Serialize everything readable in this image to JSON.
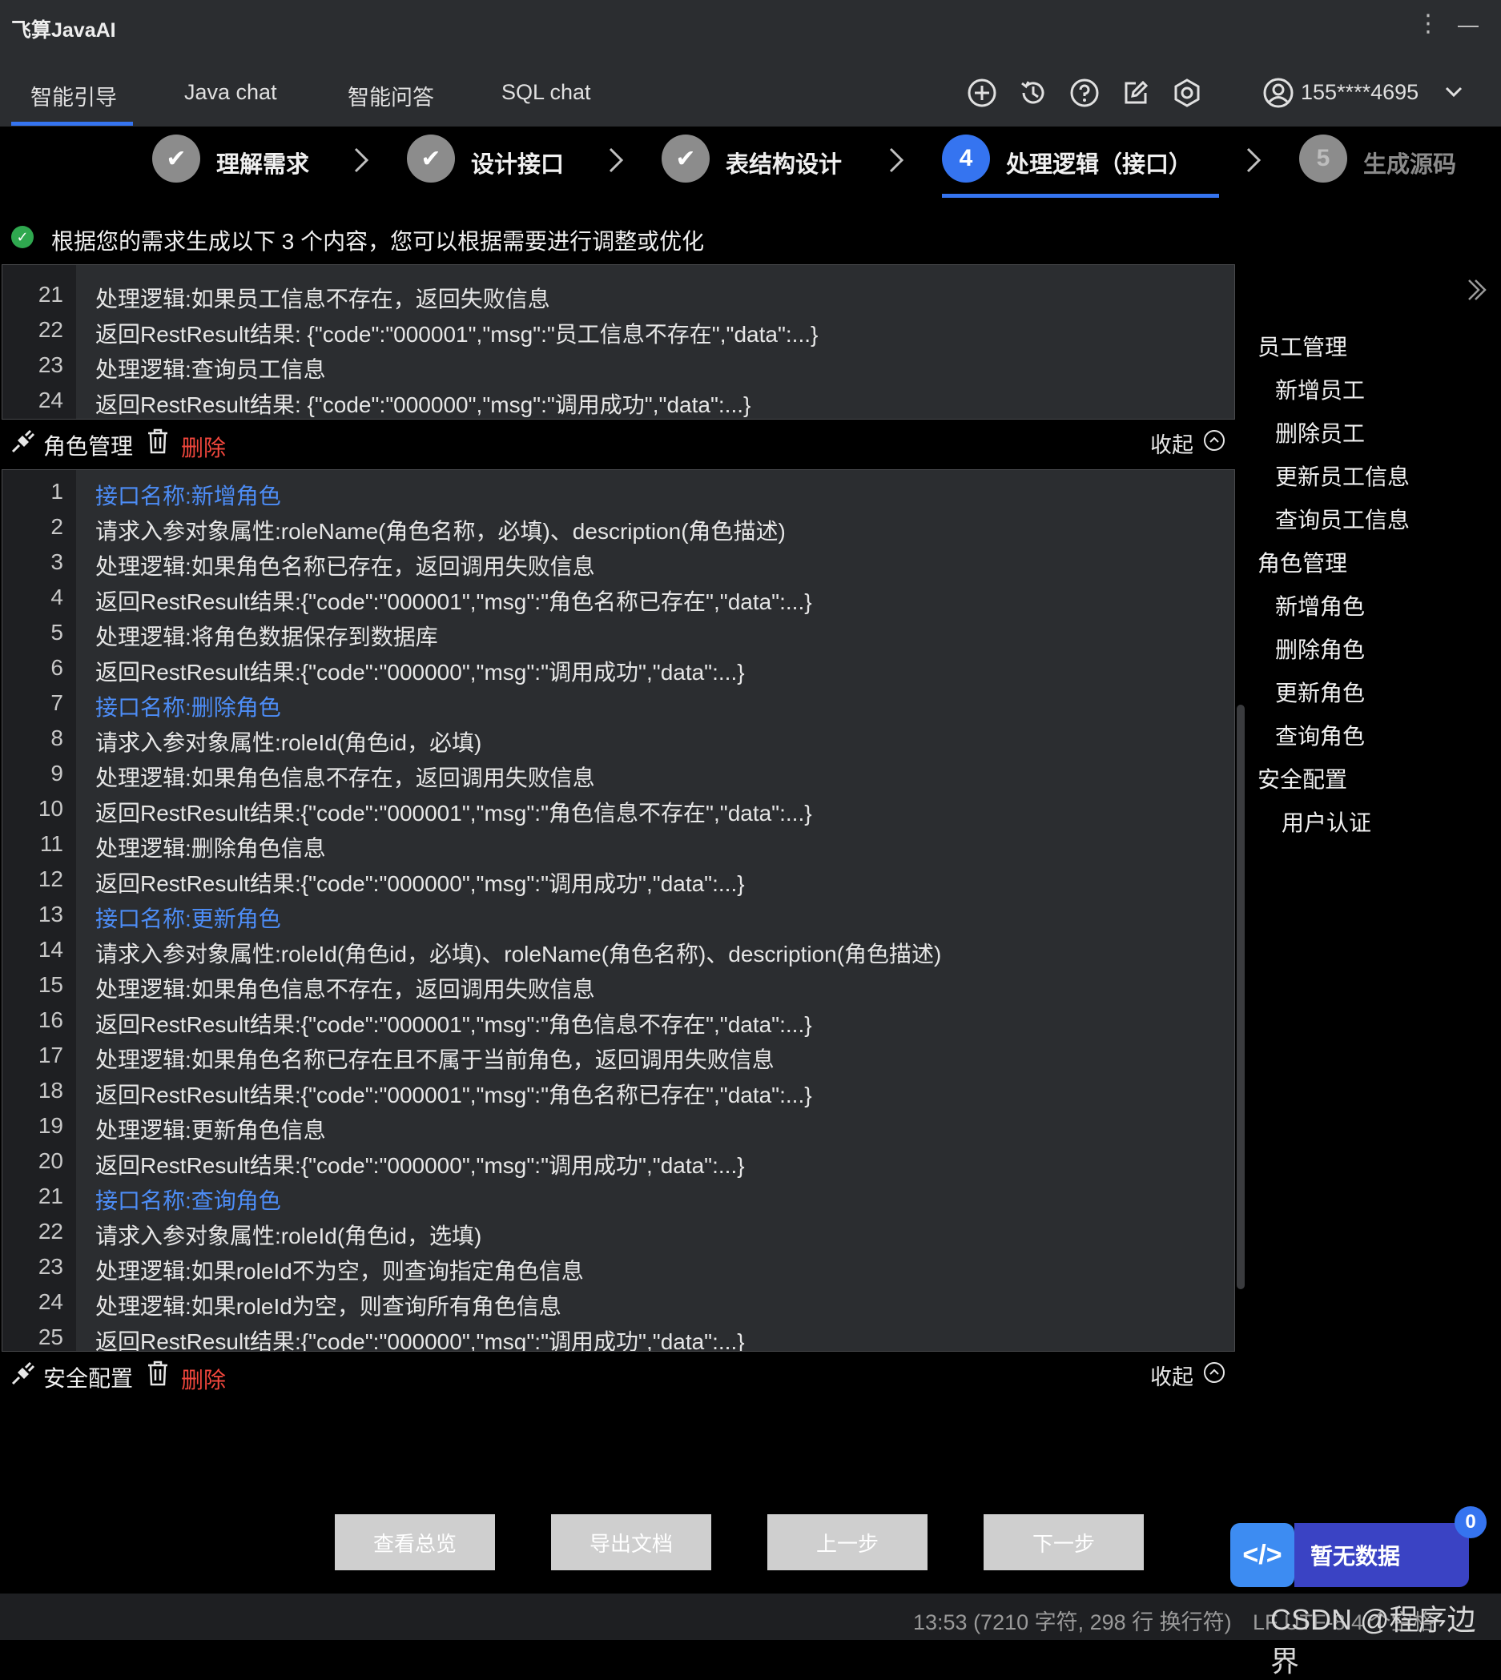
{
  "app": {
    "title": "飞算JavaAI"
  },
  "tabs": [
    "智能引导",
    "Java chat",
    "智能问答",
    "SQL chat"
  ],
  "header_icons": [
    "add-circle-icon",
    "history-icon",
    "help-icon",
    "edit-icon",
    "settings-icon"
  ],
  "user": {
    "phone": "155****4695"
  },
  "steps": [
    {
      "label": "理解需求",
      "state": "done",
      "mark": "✔"
    },
    {
      "label": "设计接口",
      "state": "done",
      "mark": "✔"
    },
    {
      "label": "表结构设计",
      "state": "done",
      "mark": "✔"
    },
    {
      "label": "处理逻辑（接口）",
      "state": "active",
      "mark": "4"
    },
    {
      "label": "生成源码",
      "state": "pending",
      "mark": "5"
    }
  ],
  "info": {
    "text": "根据您的需求生成以下 3 个内容，您可以根据需要进行调整或优化"
  },
  "top_panel": {
    "lines": [
      {
        "n": "21",
        "text": "处理逻辑:如果员工信息不存在，返回失败信息"
      },
      {
        "n": "22",
        "text": "返回RestResult结果: {\"code\":\"000001\",\"msg\":\"员工信息不存在\",\"data\":...}"
      },
      {
        "n": "23",
        "text": "处理逻辑:查询员工信息"
      },
      {
        "n": "24",
        "text": "返回RestResult结果: {\"code\":\"000000\",\"msg\":\"调用成功\",\"data\":...}"
      }
    ]
  },
  "role_section": {
    "title": "角色管理",
    "delete_label": "删除",
    "collapse_label": "收起",
    "lines": [
      {
        "n": "1",
        "text": "接口名称:新增角色",
        "hl": true
      },
      {
        "n": "2",
        "text": "请求入参对象属性:roleName(角色名称，必填)、description(角色描述)"
      },
      {
        "n": "3",
        "text": "处理逻辑:如果角色名称已存在，返回调用失败信息"
      },
      {
        "n": "4",
        "text": "返回RestResult结果:{\"code\":\"000001\",\"msg\":\"角色名称已存在\",\"data\":...}"
      },
      {
        "n": "5",
        "text": "处理逻辑:将角色数据保存到数据库"
      },
      {
        "n": "6",
        "text": "返回RestResult结果:{\"code\":\"000000\",\"msg\":\"调用成功\",\"data\":...}"
      },
      {
        "n": "7",
        "text": "接口名称:删除角色",
        "hl": true
      },
      {
        "n": "8",
        "text": "请求入参对象属性:roleId(角色id，必填)"
      },
      {
        "n": "9",
        "text": "处理逻辑:如果角色信息不存在，返回调用失败信息"
      },
      {
        "n": "10",
        "text": "返回RestResult结果:{\"code\":\"000001\",\"msg\":\"角色信息不存在\",\"data\":...}"
      },
      {
        "n": "11",
        "text": "处理逻辑:删除角色信息"
      },
      {
        "n": "12",
        "text": "返回RestResult结果:{\"code\":\"000000\",\"msg\":\"调用成功\",\"data\":...}"
      },
      {
        "n": "13",
        "text": "接口名称:更新角色",
        "hl": true
      },
      {
        "n": "14",
        "text": "请求入参对象属性:roleId(角色id，必填)、roleName(角色名称)、description(角色描述)"
      },
      {
        "n": "15",
        "text": "处理逻辑:如果角色信息不存在，返回调用失败信息"
      },
      {
        "n": "16",
        "text": "返回RestResult结果:{\"code\":\"000001\",\"msg\":\"角色信息不存在\",\"data\":...}"
      },
      {
        "n": "17",
        "text": "处理逻辑:如果角色名称已存在且不属于当前角色，返回调用失败信息"
      },
      {
        "n": "18",
        "text": "返回RestResult结果:{\"code\":\"000001\",\"msg\":\"角色名称已存在\",\"data\":...}"
      },
      {
        "n": "19",
        "text": "处理逻辑:更新角色信息"
      },
      {
        "n": "20",
        "text": "返回RestResult结果:{\"code\":\"000000\",\"msg\":\"调用成功\",\"data\":...}"
      },
      {
        "n": "21",
        "text": "接口名称:查询角色",
        "hl": true
      },
      {
        "n": "22",
        "text": "请求入参对象属性:roleId(角色id，选填)"
      },
      {
        "n": "23",
        "text": "处理逻辑:如果roleId不为空，则查询指定角色信息"
      },
      {
        "n": "24",
        "text": "处理逻辑:如果roleId为空，则查询所有角色信息"
      },
      {
        "n": "25",
        "text": "返回RestResult结果:{\"code\":\"000000\",\"msg\":\"调用成功\",\"data\":...}"
      }
    ]
  },
  "security_section": {
    "title": "安全配置",
    "delete_label": "删除",
    "collapse_label": "收起"
  },
  "outline": [
    {
      "label": "员工管理",
      "level": 0
    },
    {
      "label": "新增员工",
      "level": 1
    },
    {
      "label": "删除员工",
      "level": 1
    },
    {
      "label": "更新员工信息",
      "level": 1
    },
    {
      "label": "查询员工信息",
      "level": 1
    },
    {
      "label": "角色管理",
      "level": 0
    },
    {
      "label": "新增角色",
      "level": 1
    },
    {
      "label": "删除角色",
      "level": 1
    },
    {
      "label": "更新角色",
      "level": 1
    },
    {
      "label": "查询角色",
      "level": 1
    },
    {
      "label": "安全配置",
      "level": 0
    },
    {
      "label": "用户认证",
      "level": 2
    }
  ],
  "buttons": [
    "查看总览",
    "导出文档",
    "上一步",
    "下一步"
  ],
  "assistant": {
    "label": "暂无数据",
    "badge": "0",
    "icon_text": "</>"
  },
  "status": {
    "position": "13:53 (7210 字符, 298 行 换行符)",
    "encoding": "LF  UTF-8  4 个空格"
  },
  "watermark": "CSDN @程序边界",
  "colors": {
    "accent": "#3574f0",
    "link": "#4d8df7",
    "danger": "#f0463c",
    "success": "#2fa84f",
    "panel": "#2b2d30"
  }
}
